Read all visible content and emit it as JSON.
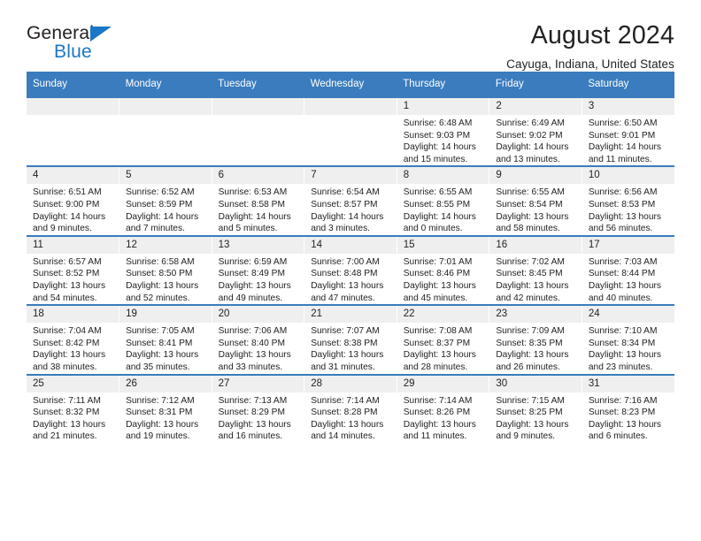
{
  "brand": {
    "name_top": "General",
    "name_bottom": "Blue",
    "accent_color": "#1a76c6"
  },
  "header": {
    "title": "August 2024",
    "subtitle": "Cayuga, Indiana, United States"
  },
  "theme": {
    "header_blue": "#3a7cbe",
    "daynum_bg": "#efefef",
    "text": "#222222"
  },
  "weekdays": [
    "Sunday",
    "Monday",
    "Tuesday",
    "Wednesday",
    "Thursday",
    "Friday",
    "Saturday"
  ],
  "labels": {
    "sunrise_prefix": "Sunrise:",
    "sunset_prefix": "Sunset:",
    "daylight_prefix": "Daylight:"
  },
  "weeks": [
    [
      {
        "day": "",
        "empty": true
      },
      {
        "day": "",
        "empty": true
      },
      {
        "day": "",
        "empty": true
      },
      {
        "day": "",
        "empty": true
      },
      {
        "day": "1",
        "sunrise": "Sunrise: 6:48 AM",
        "sunset": "Sunset: 9:03 PM",
        "daylight": "Daylight: 14 hours and 15 minutes."
      },
      {
        "day": "2",
        "sunrise": "Sunrise: 6:49 AM",
        "sunset": "Sunset: 9:02 PM",
        "daylight": "Daylight: 14 hours and 13 minutes."
      },
      {
        "day": "3",
        "sunrise": "Sunrise: 6:50 AM",
        "sunset": "Sunset: 9:01 PM",
        "daylight": "Daylight: 14 hours and 11 minutes."
      }
    ],
    [
      {
        "day": "4",
        "sunrise": "Sunrise: 6:51 AM",
        "sunset": "Sunset: 9:00 PM",
        "daylight": "Daylight: 14 hours and 9 minutes."
      },
      {
        "day": "5",
        "sunrise": "Sunrise: 6:52 AM",
        "sunset": "Sunset: 8:59 PM",
        "daylight": "Daylight: 14 hours and 7 minutes."
      },
      {
        "day": "6",
        "sunrise": "Sunrise: 6:53 AM",
        "sunset": "Sunset: 8:58 PM",
        "daylight": "Daylight: 14 hours and 5 minutes."
      },
      {
        "day": "7",
        "sunrise": "Sunrise: 6:54 AM",
        "sunset": "Sunset: 8:57 PM",
        "daylight": "Daylight: 14 hours and 3 minutes."
      },
      {
        "day": "8",
        "sunrise": "Sunrise: 6:55 AM",
        "sunset": "Sunset: 8:55 PM",
        "daylight": "Daylight: 14 hours and 0 minutes."
      },
      {
        "day": "9",
        "sunrise": "Sunrise: 6:55 AM",
        "sunset": "Sunset: 8:54 PM",
        "daylight": "Daylight: 13 hours and 58 minutes."
      },
      {
        "day": "10",
        "sunrise": "Sunrise: 6:56 AM",
        "sunset": "Sunset: 8:53 PM",
        "daylight": "Daylight: 13 hours and 56 minutes."
      }
    ],
    [
      {
        "day": "11",
        "sunrise": "Sunrise: 6:57 AM",
        "sunset": "Sunset: 8:52 PM",
        "daylight": "Daylight: 13 hours and 54 minutes."
      },
      {
        "day": "12",
        "sunrise": "Sunrise: 6:58 AM",
        "sunset": "Sunset: 8:50 PM",
        "daylight": "Daylight: 13 hours and 52 minutes."
      },
      {
        "day": "13",
        "sunrise": "Sunrise: 6:59 AM",
        "sunset": "Sunset: 8:49 PM",
        "daylight": "Daylight: 13 hours and 49 minutes."
      },
      {
        "day": "14",
        "sunrise": "Sunrise: 7:00 AM",
        "sunset": "Sunset: 8:48 PM",
        "daylight": "Daylight: 13 hours and 47 minutes."
      },
      {
        "day": "15",
        "sunrise": "Sunrise: 7:01 AM",
        "sunset": "Sunset: 8:46 PM",
        "daylight": "Daylight: 13 hours and 45 minutes."
      },
      {
        "day": "16",
        "sunrise": "Sunrise: 7:02 AM",
        "sunset": "Sunset: 8:45 PM",
        "daylight": "Daylight: 13 hours and 42 minutes."
      },
      {
        "day": "17",
        "sunrise": "Sunrise: 7:03 AM",
        "sunset": "Sunset: 8:44 PM",
        "daylight": "Daylight: 13 hours and 40 minutes."
      }
    ],
    [
      {
        "day": "18",
        "sunrise": "Sunrise: 7:04 AM",
        "sunset": "Sunset: 8:42 PM",
        "daylight": "Daylight: 13 hours and 38 minutes."
      },
      {
        "day": "19",
        "sunrise": "Sunrise: 7:05 AM",
        "sunset": "Sunset: 8:41 PM",
        "daylight": "Daylight: 13 hours and 35 minutes."
      },
      {
        "day": "20",
        "sunrise": "Sunrise: 7:06 AM",
        "sunset": "Sunset: 8:40 PM",
        "daylight": "Daylight: 13 hours and 33 minutes."
      },
      {
        "day": "21",
        "sunrise": "Sunrise: 7:07 AM",
        "sunset": "Sunset: 8:38 PM",
        "daylight": "Daylight: 13 hours and 31 minutes."
      },
      {
        "day": "22",
        "sunrise": "Sunrise: 7:08 AM",
        "sunset": "Sunset: 8:37 PM",
        "daylight": "Daylight: 13 hours and 28 minutes."
      },
      {
        "day": "23",
        "sunrise": "Sunrise: 7:09 AM",
        "sunset": "Sunset: 8:35 PM",
        "daylight": "Daylight: 13 hours and 26 minutes."
      },
      {
        "day": "24",
        "sunrise": "Sunrise: 7:10 AM",
        "sunset": "Sunset: 8:34 PM",
        "daylight": "Daylight: 13 hours and 23 minutes."
      }
    ],
    [
      {
        "day": "25",
        "sunrise": "Sunrise: 7:11 AM",
        "sunset": "Sunset: 8:32 PM",
        "daylight": "Daylight: 13 hours and 21 minutes."
      },
      {
        "day": "26",
        "sunrise": "Sunrise: 7:12 AM",
        "sunset": "Sunset: 8:31 PM",
        "daylight": "Daylight: 13 hours and 19 minutes."
      },
      {
        "day": "27",
        "sunrise": "Sunrise: 7:13 AM",
        "sunset": "Sunset: 8:29 PM",
        "daylight": "Daylight: 13 hours and 16 minutes."
      },
      {
        "day": "28",
        "sunrise": "Sunrise: 7:14 AM",
        "sunset": "Sunset: 8:28 PM",
        "daylight": "Daylight: 13 hours and 14 minutes."
      },
      {
        "day": "29",
        "sunrise": "Sunrise: 7:14 AM",
        "sunset": "Sunset: 8:26 PM",
        "daylight": "Daylight: 13 hours and 11 minutes."
      },
      {
        "day": "30",
        "sunrise": "Sunrise: 7:15 AM",
        "sunset": "Sunset: 8:25 PM",
        "daylight": "Daylight: 13 hours and 9 minutes."
      },
      {
        "day": "31",
        "sunrise": "Sunrise: 7:16 AM",
        "sunset": "Sunset: 8:23 PM",
        "daylight": "Daylight: 13 hours and 6 minutes."
      }
    ]
  ]
}
